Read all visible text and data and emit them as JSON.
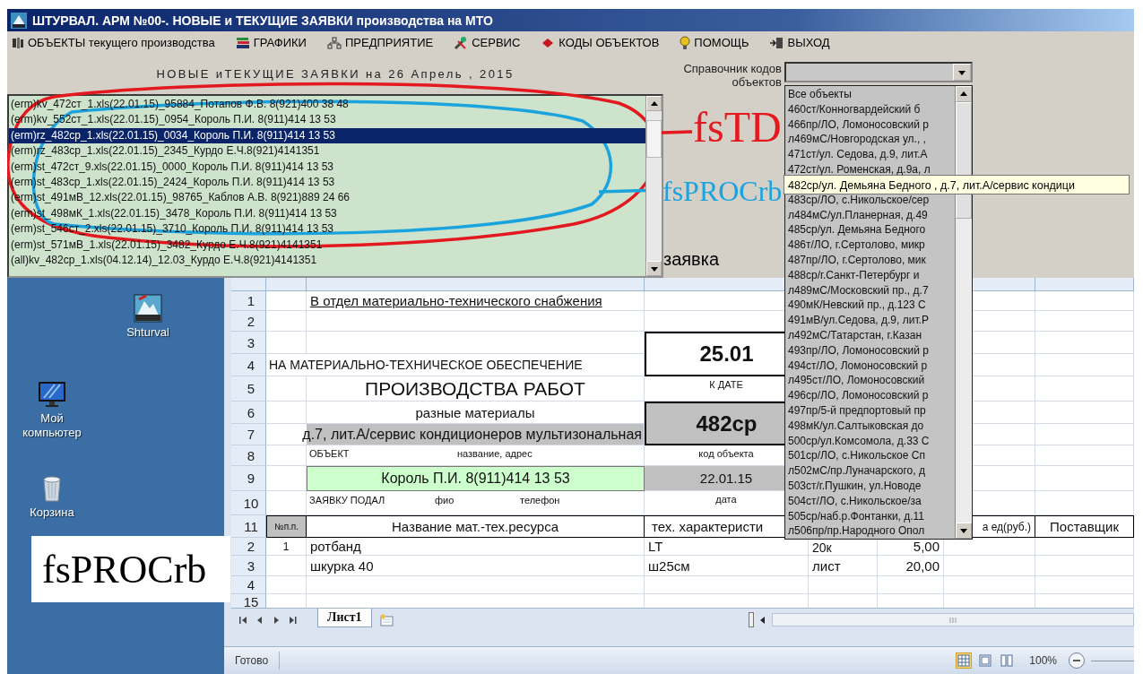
{
  "window": {
    "title": "ШТУРВАЛ. АРМ №00-. НОВЫЕ и ТЕКУЩИЕ ЗАЯВКИ производства на МТО"
  },
  "menu": [
    {
      "label": "ОБЪЕКТЫ текущего производства"
    },
    {
      "label": "ГРАФИКИ"
    },
    {
      "label": "ПРЕДПРИЯТИЕ"
    },
    {
      "label": "СЕРВИС"
    },
    {
      "label": "КОДЫ ОБЪЕКТОВ"
    },
    {
      "label": "ПОМОЩЬ"
    },
    {
      "label": "ВЫХОД"
    }
  ],
  "heading": "НОВЫЕ иТЕКУЩИЕ ЗАЯВКИ на 26 Апрель , 2015",
  "requests": [
    {
      "text": "(erm)kv_472ст_1.xls(22.01.15)_95884_Потапов Ф.В. 8(921)400 38 48",
      "selected": false
    },
    {
      "text": "(erm)kv_552ст_1.xls(22.01.15)_0954_Король П.И. 8(911)414 13 53",
      "selected": false
    },
    {
      "text": "(erm)rz_482ср_1.xls(22.01.15)_0034_Король П.И. 8(911)414 13 53",
      "selected": true
    },
    {
      "text": "(erm)rz_483ср_1.xls(22.01.15)_2345_Курдо Е.Ч.8(921)4141351",
      "selected": false
    },
    {
      "text": "(erm)st_472ст_9.xls(22.01.15)_0000_Король П.И. 8(911)414 13 53",
      "selected": false
    },
    {
      "text": "(erm)st_483ср_1.xls(22.01.15)_2424_Король П.И. 8(911)414 13 53",
      "selected": false
    },
    {
      "text": "(erm)st_491мВ_12.xls(22.01.15)_98765_Каблов А.В. 8(921)889 24 66",
      "selected": false
    },
    {
      "text": "(erm)st_498мК_1.xls(22.01.15)_3478_Король П.И. 8(911)414 13 53",
      "selected": false
    },
    {
      "text": "(erm)st_546ст_2.xls(22.01.15)_3710_Король П.И. 8(911)414 13 53",
      "selected": false
    },
    {
      "text": "(erm)st_571мВ_1.xls(22.01.15)_3482_Курдо Е.Ч.8(921)4141351",
      "selected": false
    },
    {
      "text": "(all)kv_482ср_1.xls(04.12.14)_12.03_Курдо Е.Ч.8(921)4141351",
      "selected": false
    }
  ],
  "object_codes": {
    "label": "Справочник кодов\nобъектов",
    "expanded": true,
    "items": [
      {
        "kind": "item",
        "text": "Все объекты"
      },
      {
        "kind": "item",
        "text": "460ст/Конногвардейский б"
      },
      {
        "kind": "item",
        "text": "466пр/ЛО, Ломоносовский р"
      },
      {
        "kind": "item",
        "text": "л469мС/Новгородская ул., ,"
      },
      {
        "kind": "item",
        "text": "471ст/ул. Седова, д.9, лит.А"
      },
      {
        "kind": "item",
        "text": "472ст/ул. Роменская, д.9а, л"
      },
      {
        "kind": "tooltip",
        "text": "482ср/ул. Демьяна Бедного , д.7, лит.А/сервис кондици"
      },
      {
        "kind": "item",
        "text": "483ср/ЛО, с.Никольское/сер"
      },
      {
        "kind": "item",
        "text": "л484мС/ул.Планерная, д.49"
      },
      {
        "kind": "item",
        "text": "485ср/ул. Демьяна Бедного"
      },
      {
        "kind": "item",
        "text": "486т/ЛО, г.Сертолово, микр"
      },
      {
        "kind": "item",
        "text": "487пр/ЛО, г.Сертолово, мик"
      },
      {
        "kind": "item",
        "text": "488ср/г.Санкт-Петербург и"
      },
      {
        "kind": "item",
        "text": "л489мС/Московский пр., д.7"
      },
      {
        "kind": "item",
        "text": "490мК/Невский пр., д.123 С"
      },
      {
        "kind": "item",
        "text": "491мВ/ул.Седова, д.9, лит.Р"
      },
      {
        "kind": "item",
        "text": "л492мС/Татарстан, г.Казан"
      },
      {
        "kind": "item",
        "text": "493пр/ЛО, Ломоносовский р"
      },
      {
        "kind": "item",
        "text": "494ст/ЛО, Ломоносовский р"
      },
      {
        "kind": "item",
        "text": "л495ст/ЛО, Ломоносовский"
      },
      {
        "kind": "item",
        "text": "496ср/ЛО, Ломоносовский р"
      },
      {
        "kind": "item",
        "text": "497пр/5-й предпортовый пр"
      },
      {
        "kind": "item",
        "text": "498мК/ул.Салтыковская до"
      },
      {
        "kind": "item",
        "text": "500ср/ул.Комсомола, д.33 С"
      },
      {
        "kind": "item",
        "text": "501ср/ЛО, с.Никольское Сп"
      },
      {
        "kind": "item",
        "text": "л502мС/пр.Луначарского, д"
      },
      {
        "kind": "item",
        "text": "503ст/г.Пушкин, ул.Новоде"
      },
      {
        "kind": "item",
        "text": "504ст/ЛО, с.Никольское/за"
      },
      {
        "kind": "item",
        "text": "505ср/наб.р.Фонтанки, д.11"
      },
      {
        "kind": "item",
        "text": "л506пр/пр.Народного Опол"
      }
    ]
  },
  "caption": "заявка",
  "desktop_icons": [
    {
      "label": "Shturval"
    },
    {
      "label": "Мой компьютер"
    },
    {
      "label": "Корзина"
    }
  ],
  "sheet": {
    "rows": [
      {
        "number": "1",
        "cells": {
          "B": {
            "kind": "underlined",
            "text": "В отдел материально-технического снабжения"
          }
        }
      },
      {
        "number": "2"
      },
      {
        "number": "3",
        "cells": {
          "C": {
            "kind": "date-box",
            "text": "25.01"
          }
        }
      },
      {
        "number": "4",
        "cells": {
          "A": {
            "kind": "wide",
            "text": "НА МАТЕРИАЛЬНО-ТЕХНИЧЕСКОЕ ОБЕСПЕЧЕНИЕ"
          }
        }
      },
      {
        "number": "5",
        "cells": {
          "B": {
            "kind": "heading",
            "text": "ПРОИЗВОДСТВА РАБОТ"
          },
          "C": {
            "kind": "caption",
            "text": "К ДАТЕ"
          }
        }
      },
      {
        "number": "6",
        "cells": {
          "B": {
            "kind": "center",
            "text": "разные материалы"
          },
          "C": {
            "kind": "code-box",
            "text": "482ср"
          }
        }
      },
      {
        "number": "7",
        "cells": {
          "A": {
            "kind": "address",
            "text": "д.7, лит.А/сервис кондиционеров мультизональная"
          }
        }
      },
      {
        "number": "8",
        "cells": {
          "B": {
            "kind": "captions-object",
            "texts": [
              "ОБЪЕКТ",
              "название, адрес"
            ]
          },
          "C": {
            "kind": "caption",
            "text": "код объекта"
          }
        }
      },
      {
        "number": "9",
        "cells": {
          "B": {
            "kind": "person",
            "text": "Король П.И. 8(911)414 13 53"
          },
          "C": {
            "kind": "date",
            "text": "22.01.15"
          }
        }
      },
      {
        "number": "10",
        "cells": {
          "B": {
            "kind": "captions-requester",
            "texts": [
              "ЗАЯВКУ ПОДАЛ",
              "фио",
              "телефон"
            ]
          },
          "C": {
            "kind": "caption",
            "text": "дата"
          }
        }
      },
      {
        "number": "11",
        "cells": {
          "A": {
            "kind": "index-head",
            "text": "№п.п."
          },
          "B": {
            "kind": "header",
            "text": "Название мат.-тех.ресурса"
          },
          "C": {
            "kind": "header-left",
            "text": "тех. характеристи"
          },
          "F": {
            "kind": "header-right",
            "text": "а ед(руб.)"
          },
          "G": {
            "kind": "header",
            "text": "Поставщик"
          }
        }
      },
      {
        "number": "2",
        "cells": {
          "A": {
            "kind": "index",
            "text": "1"
          },
          "B": {
            "kind": "text",
            "text": "ротбанд"
          },
          "C": {
            "kind": "text",
            "text": "LT"
          },
          "D": {
            "kind": "low-text",
            "text": "20к"
          },
          "E": {
            "kind": "number",
            "text": "5,00"
          }
        }
      },
      {
        "number": "3",
        "cells": {
          "B": {
            "kind": "text",
            "text": "шкурка 40"
          },
          "C": {
            "kind": "text",
            "text": "ш25см"
          },
          "D": {
            "kind": "text",
            "text": "лист"
          },
          "E": {
            "kind": "number",
            "text": "20,00"
          }
        }
      },
      {
        "number": "4"
      },
      {
        "number": "15"
      }
    ],
    "tabs": [
      {
        "label": "Лист1",
        "selected": true
      }
    ],
    "status": "Готово",
    "views": [
      {
        "selected": true
      },
      {
        "selected": false
      },
      {
        "selected": false
      }
    ],
    "zoom": "100%"
  },
  "annotations": [
    {
      "text": "fsTD",
      "color": "#e3191f"
    },
    {
      "text": "fsPROCrb",
      "color": "#1ba3de"
    }
  ],
  "note": {
    "text": "fsPROCrb"
  }
}
